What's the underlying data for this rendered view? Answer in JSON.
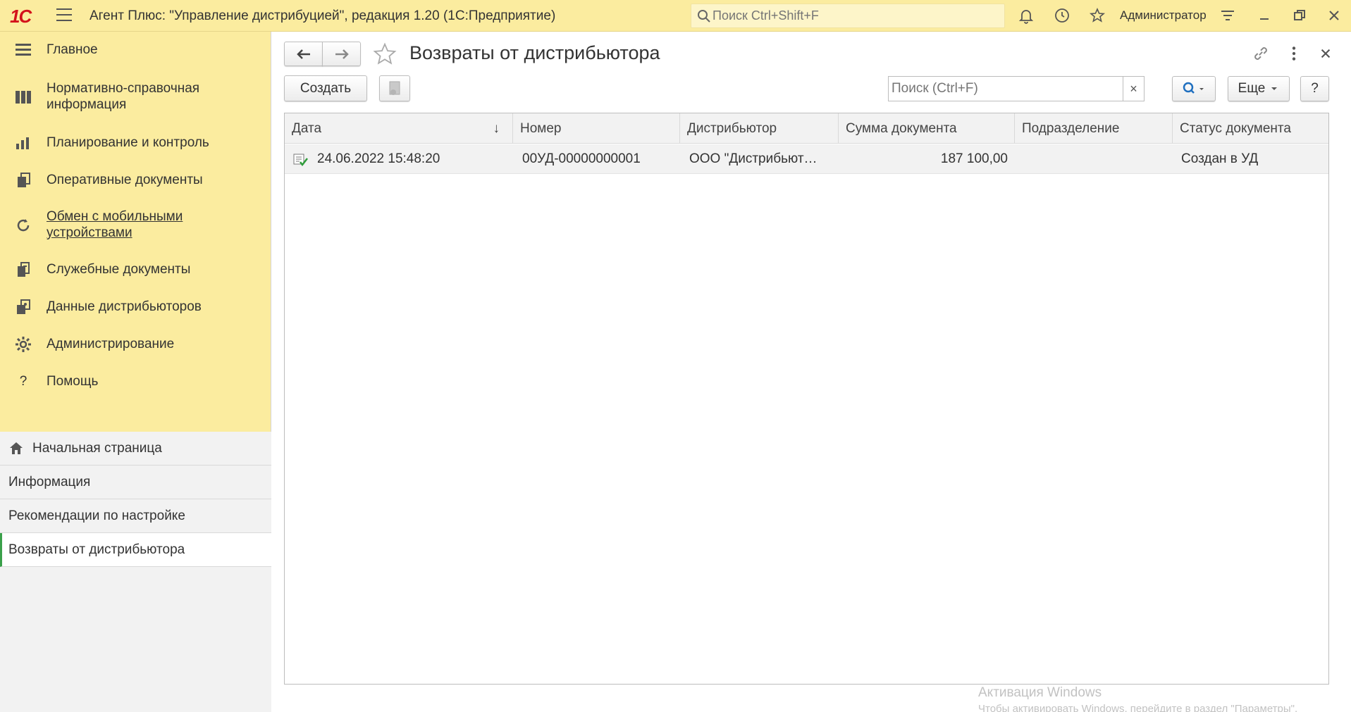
{
  "topbar": {
    "logo": "1С",
    "title": "Агент Плюс: \"Управление дистрибуцией\", редакция 1.20  (1С:Предприятие)",
    "search_placeholder": "Поиск Ctrl+Shift+F",
    "user": "Администратор",
    "icons": [
      "bell-icon",
      "history-icon",
      "favorites-star-icon",
      "settings-menu-icon",
      "minimize-icon",
      "restore-icon",
      "close-icon"
    ]
  },
  "sidebar": {
    "items": [
      {
        "label": "Главное",
        "icon": "menu-lines-icon"
      },
      {
        "label": "Нормативно-справочная информация",
        "icon": "catalog-icon"
      },
      {
        "label": "Планирование и контроль",
        "icon": "chart-icon"
      },
      {
        "label": "Оперативные документы",
        "icon": "documents-icon"
      },
      {
        "label": "Обмен с мобильными устройствами",
        "icon": "sync-icon"
      },
      {
        "label": "Служебные документы",
        "icon": "service-docs-icon"
      },
      {
        "label": "Данные дистрибьюторов",
        "icon": "distributor-data-icon"
      },
      {
        "label": "Администрирование",
        "icon": "gear-icon"
      },
      {
        "label": "Помощь",
        "icon": "help-icon"
      }
    ],
    "open_windows": [
      {
        "label": "Начальная страница",
        "icon": "home-icon"
      },
      {
        "label": "Информация"
      },
      {
        "label": "Рекомендации по настройке"
      },
      {
        "label": "Возвраты от дистрибьютора"
      }
    ]
  },
  "form": {
    "title": "Возвраты от дистрибьютора",
    "create_label": "Создать",
    "search_placeholder": "Поиск (Ctrl+F)",
    "clear_label": "×",
    "more_label": "Еще",
    "help_label": "?",
    "columns": [
      "Дата",
      "Номер",
      "Дистрибьютор",
      "Сумма документа",
      "Подразделение",
      "Статус документа"
    ],
    "sort_indicator": "↓",
    "rows": [
      {
        "date": "24.06.2022 15:48:20",
        "number": "00УД-00000000001",
        "distributor": "ООО \"Дистрибьют…",
        "sum": "187 100,00",
        "department": "",
        "status": "Создан в УД"
      }
    ]
  },
  "watermark": {
    "title": "Активация Windows",
    "text": "Чтобы активировать Windows, перейдите в раздел \"Параметры\"."
  },
  "colors": {
    "panel": "#fbec9f",
    "accent_green": "#3aa04a",
    "logo_red": "#d3121b"
  }
}
